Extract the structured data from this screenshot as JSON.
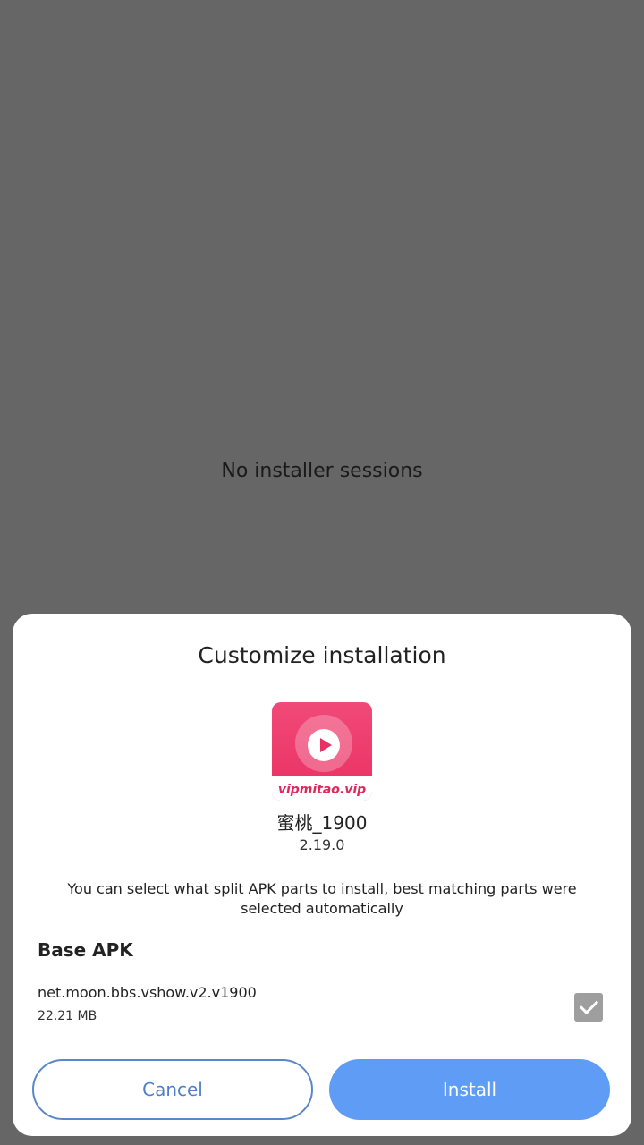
{
  "background": {
    "empty_message": "No installer sessions"
  },
  "dialog": {
    "title": "Customize installation",
    "app": {
      "icon_name": "app-icon",
      "icon_brand_text": "vipmitao.vip",
      "name": "蜜桃_1900",
      "version": "2.19.0"
    },
    "description": "You can select what split APK parts to install, best matching parts were selected automatically",
    "section_title": "Base APK",
    "apk": {
      "package": "net.moon.bbs.vshow.v2.v1900",
      "size": "22.21 MB",
      "checked": true
    },
    "cancel_label": "Cancel",
    "install_label": "Install"
  },
  "colors": {
    "overlay": "#666666",
    "accent": "#5f9cf5",
    "accent_text": "#4f7fca",
    "icon_pink": "#ea2f63"
  }
}
